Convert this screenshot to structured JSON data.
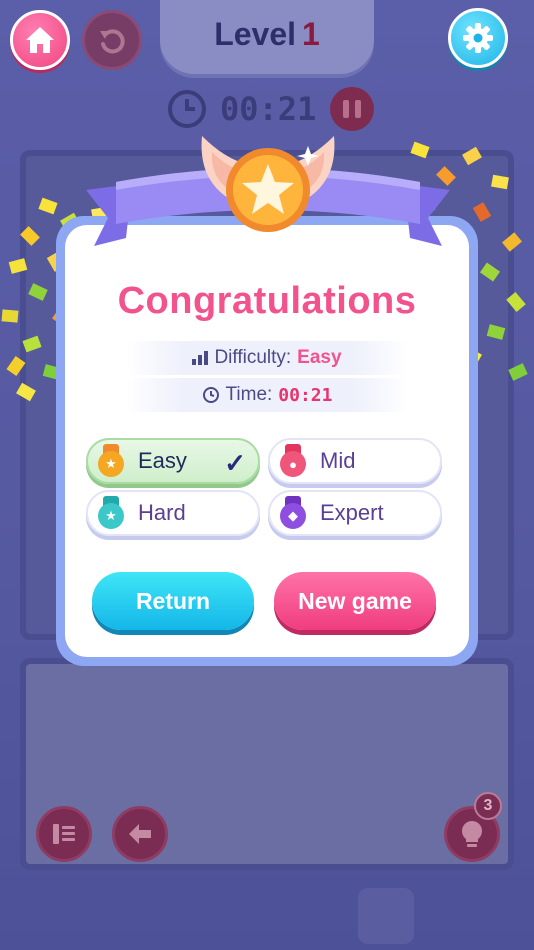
{
  "header": {
    "level_label": "Level",
    "level_number": "1",
    "timer": "00:21"
  },
  "dialog": {
    "title": "Congratulations",
    "difficulty_label": "Difficulty:",
    "difficulty_value": "Easy",
    "time_label": "Time:",
    "time_value": "00:21",
    "options": [
      {
        "label": "Easy",
        "selected": true,
        "color": "#f5a623"
      },
      {
        "label": "Mid",
        "selected": false,
        "color": "#f0557a"
      },
      {
        "label": "Hard",
        "selected": false,
        "color": "#3cc8c8"
      },
      {
        "label": "Expert",
        "selected": false,
        "color": "#8e4fe0"
      }
    ],
    "check_mark": "✓",
    "return_label": "Return",
    "new_game_label": "New game"
  },
  "footer": {
    "hint_count": "3"
  },
  "colors": {
    "accent_pink": "#f2538c",
    "accent_cyan": "#14b6e8",
    "dialog_border": "#8ea7f3"
  },
  "icons": {
    "home": "home-icon",
    "undo": "undo-icon",
    "settings": "gear-icon",
    "clock": "clock-icon",
    "pause": "pause-icon",
    "sort": "sort-icon",
    "back": "arrow-left-icon",
    "hint": "lightbulb-icon",
    "medal": "star-medal-icon"
  }
}
